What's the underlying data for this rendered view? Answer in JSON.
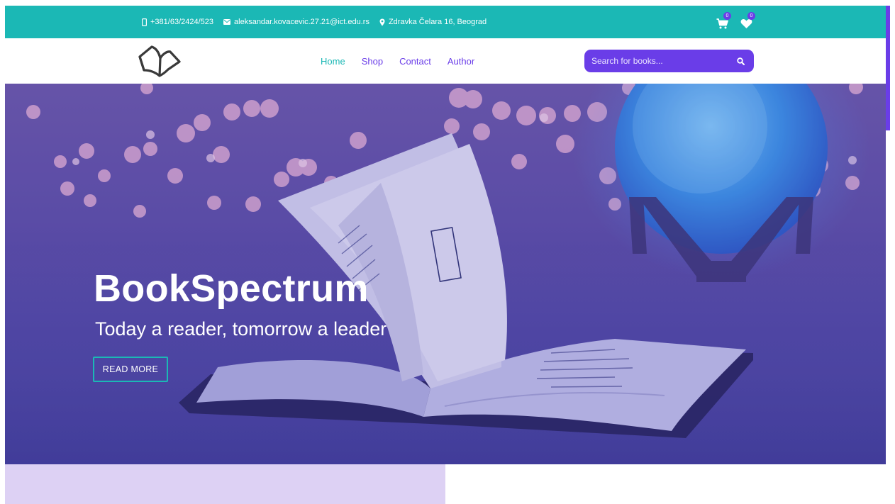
{
  "contact": {
    "phone": "+381/63/2424/523",
    "email": "aleksandar.kovacevic.27.21@ict.edu.rs",
    "address": "Zdravka Čelara 16, Beograd",
    "phone_icon": "mobile-phone-icon",
    "email_icon": "envelope-icon",
    "address_icon": "map-marker-icon"
  },
  "header_icons": {
    "cart_count": "0",
    "wishlist_count": "0",
    "cart_icon": "shopping-cart-icon",
    "wishlist_icon": "heart-icon"
  },
  "nav": {
    "logo_icon": "open-book-logo-icon",
    "items": [
      "Home",
      "Shop",
      "Contact",
      "Author"
    ],
    "active": "Home"
  },
  "search": {
    "placeholder": "Search for books...",
    "icon": "magnifier-icon"
  },
  "hero": {
    "title": "BookSpectrum",
    "subtitle": "Today a reader, tomorrow a leader",
    "button_label": "READ MORE"
  },
  "colors": {
    "teal": "#1bb8b5",
    "purple": "#6a3de8",
    "lavender": "#ddd1f4"
  }
}
